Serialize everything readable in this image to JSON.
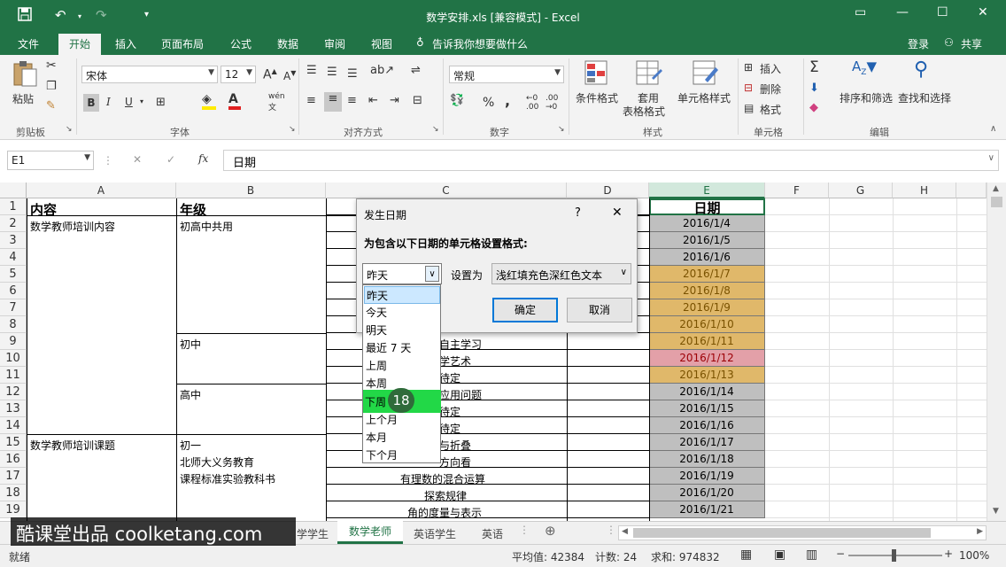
{
  "window": {
    "title": "数学安排.xls  [兼容模式] - Excel"
  },
  "tabs": [
    "文件",
    "开始",
    "插入",
    "页面布局",
    "公式",
    "数据",
    "审阅",
    "视图"
  ],
  "tellme": "告诉我你想要做什么",
  "account": {
    "login": "登录",
    "share": "共享"
  },
  "ribbon": {
    "paste": "粘贴",
    "clipboard": "剪贴板",
    "font_name": "宋体",
    "font_size": "12",
    "bold": "B",
    "italic": "I",
    "underline": "U",
    "font_group": "字体",
    "align_group": "对齐方式",
    "number_format": "常规",
    "percent": "%",
    "comma": ",",
    "number_group": "数字",
    "cond_format": "条件格式",
    "table_format_1": "套用",
    "table_format_2": "表格格式",
    "cell_style": "单元格样式",
    "styles_group": "样式",
    "insert": "插入",
    "delete": "删除",
    "format": "格式",
    "cells_group": "单元格",
    "sort_filter": "排序和筛选",
    "find_select": "查找和选择",
    "editing_group": "编辑"
  },
  "formula_bar": {
    "name_box": "E1",
    "fx": "fx",
    "content": "日期"
  },
  "columns": [
    "A",
    "B",
    "C",
    "D",
    "E",
    "F",
    "G",
    "H"
  ],
  "rows": [
    "1",
    "2",
    "3",
    "4",
    "5",
    "6",
    "7",
    "8",
    "9",
    "10",
    "11",
    "12",
    "13",
    "14",
    "15",
    "16",
    "17",
    "18",
    "19"
  ],
  "cells": {
    "a1": "内容",
    "b1": "年级",
    "e1": "日期",
    "a2": "数学教师培训内容",
    "b2": "初高中共用",
    "b9": "初中",
    "b12": "高中",
    "a15": "数学教师培训课题",
    "b15": "初一",
    "b16": "北师大义务教育",
    "b17": "课程标准实验教科书",
    "c9": "自主学习",
    "c10": "学艺术",
    "c11": "待定",
    "c12": "应用问题",
    "c13": "待定",
    "c14": "待定",
    "c15": "与折叠",
    "c16": "方向看",
    "c17": "有理数的混合运算",
    "c18": "探索规律",
    "c19": "角的度量与表示"
  },
  "dates": [
    "2016/1/4",
    "2016/1/5",
    "2016/1/6",
    "2016/1/7",
    "2016/1/8",
    "2016/1/9",
    "2016/1/10",
    "2016/1/11",
    "2016/1/12",
    "2016/1/13",
    "2016/1/14",
    "2016/1/15",
    "2016/1/16",
    "2016/1/17",
    "2016/1/18",
    "2016/1/19",
    "2016/1/20",
    "2016/1/21"
  ],
  "dialog": {
    "title": "发生日期",
    "help": "?",
    "close": "✕",
    "prompt": "为包含以下日期的单元格设置格式:",
    "selected": "昨天",
    "set_as": "设置为",
    "format_value": "浅红填充色深红色文本",
    "ok": "确定",
    "cancel": "取消",
    "options": [
      "昨天",
      "今天",
      "明天",
      "最近 7 天",
      "上周",
      "本周",
      "下周",
      "上个月",
      "本月",
      "下个月"
    ]
  },
  "step_badge": "18",
  "sheet_tabs": [
    "学学生",
    "数学老师",
    "英语学生",
    "英语"
  ],
  "status": {
    "ready": "就绪",
    "average": "平均值: 42384",
    "count": "计数: 24",
    "sum": "求和: 974832",
    "zoom": "100%"
  },
  "watermark": "酷课堂出品  coolketang.com",
  "colors": {
    "excel_green": "#217346",
    "orange_fill": "#e0b86a",
    "red_fill": "#e3a0a8",
    "gray_fill": "#bfbfbf",
    "highlight_green": "#22d847"
  }
}
